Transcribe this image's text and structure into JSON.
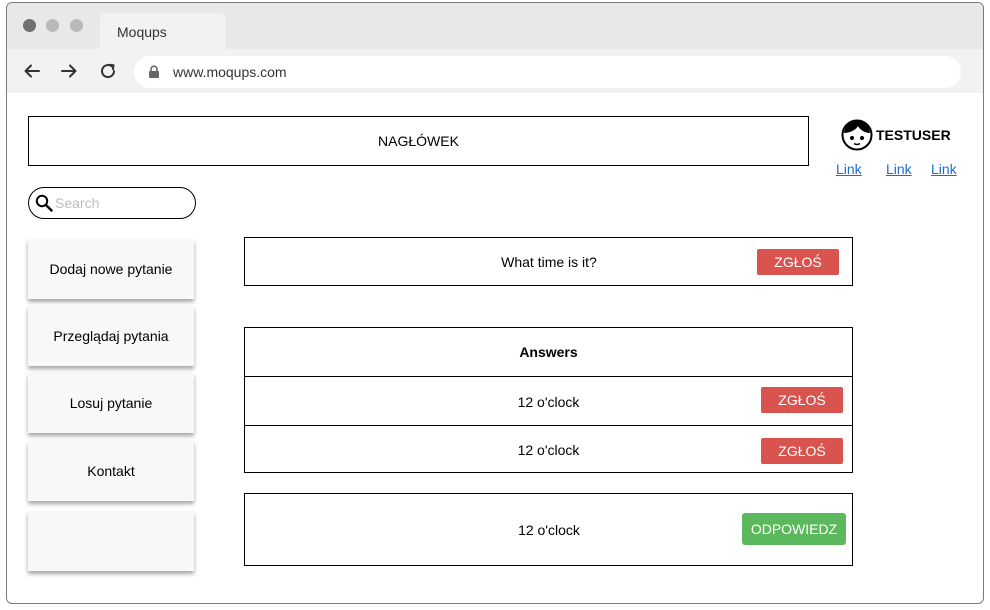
{
  "browser": {
    "tab_title": "Moqups",
    "url": "www.moqups.com"
  },
  "header": {
    "title": "NAGŁÓWEK"
  },
  "user": {
    "name": "TESTUSER",
    "links": [
      "Link",
      "Link",
      "Link"
    ]
  },
  "search": {
    "placeholder": "Search",
    "value": ""
  },
  "sidebar": {
    "items": [
      {
        "label": "Dodaj nowe pytanie"
      },
      {
        "label": "Przeglądaj pytania"
      },
      {
        "label": "Losuj pytanie"
      },
      {
        "label": "Kontakt"
      },
      {
        "label": ""
      }
    ]
  },
  "question": {
    "text": "What time is it?",
    "report_label": "ZGŁOŚ"
  },
  "answers": {
    "header": "Answers",
    "rows": [
      {
        "text": "12 o'clock",
        "report_label": "ZGŁOŚ"
      },
      {
        "text": "12 o'clock",
        "report_label": "ZGŁOŚ"
      }
    ]
  },
  "reply": {
    "text": "12 o'clock",
    "button_label": "ODPOWIEDZ"
  },
  "colors": {
    "report_button": "#d9534f",
    "reply_button": "#5cb85c",
    "link": "#1a6ecb"
  }
}
